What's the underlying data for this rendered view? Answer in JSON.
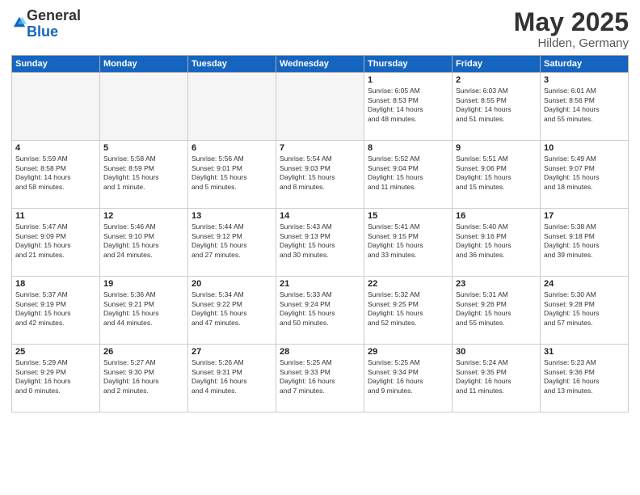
{
  "logo": {
    "general": "General",
    "blue": "Blue"
  },
  "title": "May 2025",
  "location": "Hilden, Germany",
  "days_header": [
    "Sunday",
    "Monday",
    "Tuesday",
    "Wednesday",
    "Thursday",
    "Friday",
    "Saturday"
  ],
  "weeks": [
    [
      {
        "day": "",
        "lines": []
      },
      {
        "day": "",
        "lines": []
      },
      {
        "day": "",
        "lines": []
      },
      {
        "day": "",
        "lines": []
      },
      {
        "day": "1",
        "lines": [
          "Sunrise: 6:05 AM",
          "Sunset: 8:53 PM",
          "Daylight: 14 hours",
          "and 48 minutes."
        ]
      },
      {
        "day": "2",
        "lines": [
          "Sunrise: 6:03 AM",
          "Sunset: 8:55 PM",
          "Daylight: 14 hours",
          "and 51 minutes."
        ]
      },
      {
        "day": "3",
        "lines": [
          "Sunrise: 6:01 AM",
          "Sunset: 8:56 PM",
          "Daylight: 14 hours",
          "and 55 minutes."
        ]
      }
    ],
    [
      {
        "day": "4",
        "lines": [
          "Sunrise: 5:59 AM",
          "Sunset: 8:58 PM",
          "Daylight: 14 hours",
          "and 58 minutes."
        ]
      },
      {
        "day": "5",
        "lines": [
          "Sunrise: 5:58 AM",
          "Sunset: 8:59 PM",
          "Daylight: 15 hours",
          "and 1 minute."
        ]
      },
      {
        "day": "6",
        "lines": [
          "Sunrise: 5:56 AM",
          "Sunset: 9:01 PM",
          "Daylight: 15 hours",
          "and 5 minutes."
        ]
      },
      {
        "day": "7",
        "lines": [
          "Sunrise: 5:54 AM",
          "Sunset: 9:03 PM",
          "Daylight: 15 hours",
          "and 8 minutes."
        ]
      },
      {
        "day": "8",
        "lines": [
          "Sunrise: 5:52 AM",
          "Sunset: 9:04 PM",
          "Daylight: 15 hours",
          "and 11 minutes."
        ]
      },
      {
        "day": "9",
        "lines": [
          "Sunrise: 5:51 AM",
          "Sunset: 9:06 PM",
          "Daylight: 15 hours",
          "and 15 minutes."
        ]
      },
      {
        "day": "10",
        "lines": [
          "Sunrise: 5:49 AM",
          "Sunset: 9:07 PM",
          "Daylight: 15 hours",
          "and 18 minutes."
        ]
      }
    ],
    [
      {
        "day": "11",
        "lines": [
          "Sunrise: 5:47 AM",
          "Sunset: 9:09 PM",
          "Daylight: 15 hours",
          "and 21 minutes."
        ]
      },
      {
        "day": "12",
        "lines": [
          "Sunrise: 5:46 AM",
          "Sunset: 9:10 PM",
          "Daylight: 15 hours",
          "and 24 minutes."
        ]
      },
      {
        "day": "13",
        "lines": [
          "Sunrise: 5:44 AM",
          "Sunset: 9:12 PM",
          "Daylight: 15 hours",
          "and 27 minutes."
        ]
      },
      {
        "day": "14",
        "lines": [
          "Sunrise: 5:43 AM",
          "Sunset: 9:13 PM",
          "Daylight: 15 hours",
          "and 30 minutes."
        ]
      },
      {
        "day": "15",
        "lines": [
          "Sunrise: 5:41 AM",
          "Sunset: 9:15 PM",
          "Daylight: 15 hours",
          "and 33 minutes."
        ]
      },
      {
        "day": "16",
        "lines": [
          "Sunrise: 5:40 AM",
          "Sunset: 9:16 PM",
          "Daylight: 15 hours",
          "and 36 minutes."
        ]
      },
      {
        "day": "17",
        "lines": [
          "Sunrise: 5:38 AM",
          "Sunset: 9:18 PM",
          "Daylight: 15 hours",
          "and 39 minutes."
        ]
      }
    ],
    [
      {
        "day": "18",
        "lines": [
          "Sunrise: 5:37 AM",
          "Sunset: 9:19 PM",
          "Daylight: 15 hours",
          "and 42 minutes."
        ]
      },
      {
        "day": "19",
        "lines": [
          "Sunrise: 5:36 AM",
          "Sunset: 9:21 PM",
          "Daylight: 15 hours",
          "and 44 minutes."
        ]
      },
      {
        "day": "20",
        "lines": [
          "Sunrise: 5:34 AM",
          "Sunset: 9:22 PM",
          "Daylight: 15 hours",
          "and 47 minutes."
        ]
      },
      {
        "day": "21",
        "lines": [
          "Sunrise: 5:33 AM",
          "Sunset: 9:24 PM",
          "Daylight: 15 hours",
          "and 50 minutes."
        ]
      },
      {
        "day": "22",
        "lines": [
          "Sunrise: 5:32 AM",
          "Sunset: 9:25 PM",
          "Daylight: 15 hours",
          "and 52 minutes."
        ]
      },
      {
        "day": "23",
        "lines": [
          "Sunrise: 5:31 AM",
          "Sunset: 9:26 PM",
          "Daylight: 15 hours",
          "and 55 minutes."
        ]
      },
      {
        "day": "24",
        "lines": [
          "Sunrise: 5:30 AM",
          "Sunset: 9:28 PM",
          "Daylight: 15 hours",
          "and 57 minutes."
        ]
      }
    ],
    [
      {
        "day": "25",
        "lines": [
          "Sunrise: 5:29 AM",
          "Sunset: 9:29 PM",
          "Daylight: 16 hours",
          "and 0 minutes."
        ]
      },
      {
        "day": "26",
        "lines": [
          "Sunrise: 5:27 AM",
          "Sunset: 9:30 PM",
          "Daylight: 16 hours",
          "and 2 minutes."
        ]
      },
      {
        "day": "27",
        "lines": [
          "Sunrise: 5:26 AM",
          "Sunset: 9:31 PM",
          "Daylight: 16 hours",
          "and 4 minutes."
        ]
      },
      {
        "day": "28",
        "lines": [
          "Sunrise: 5:25 AM",
          "Sunset: 9:33 PM",
          "Daylight: 16 hours",
          "and 7 minutes."
        ]
      },
      {
        "day": "29",
        "lines": [
          "Sunrise: 5:25 AM",
          "Sunset: 9:34 PM",
          "Daylight: 16 hours",
          "and 9 minutes."
        ]
      },
      {
        "day": "30",
        "lines": [
          "Sunrise: 5:24 AM",
          "Sunset: 9:35 PM",
          "Daylight: 16 hours",
          "and 11 minutes."
        ]
      },
      {
        "day": "31",
        "lines": [
          "Sunrise: 5:23 AM",
          "Sunset: 9:36 PM",
          "Daylight: 16 hours",
          "and 13 minutes."
        ]
      }
    ]
  ]
}
